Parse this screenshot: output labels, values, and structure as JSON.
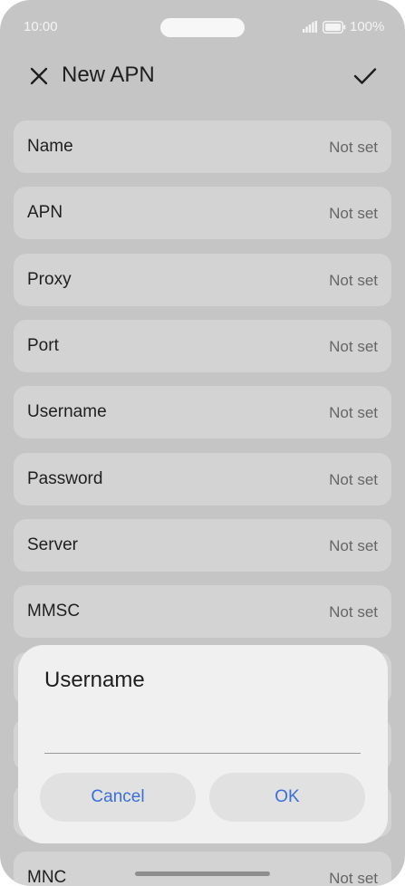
{
  "status_bar": {
    "time": "10:00",
    "battery": "100%"
  },
  "header": {
    "title": "New APN"
  },
  "rows": [
    {
      "label": "Name",
      "value": "Not set"
    },
    {
      "label": "APN",
      "value": "Not set"
    },
    {
      "label": "Proxy",
      "value": "Not set"
    },
    {
      "label": "Port",
      "value": "Not set"
    },
    {
      "label": "Username",
      "value": "Not set"
    },
    {
      "label": "Password",
      "value": "Not set"
    },
    {
      "label": "Server",
      "value": "Not set"
    },
    {
      "label": "MMSC",
      "value": "Not set"
    },
    {
      "label": "MNC",
      "value": "Not set"
    }
  ],
  "dialog": {
    "title": "Username",
    "input_value": "",
    "cancel_label": "Cancel",
    "ok_label": "OK"
  },
  "colors": {
    "accent": "#3a6fd8",
    "scrim": "#c5c5c5"
  }
}
